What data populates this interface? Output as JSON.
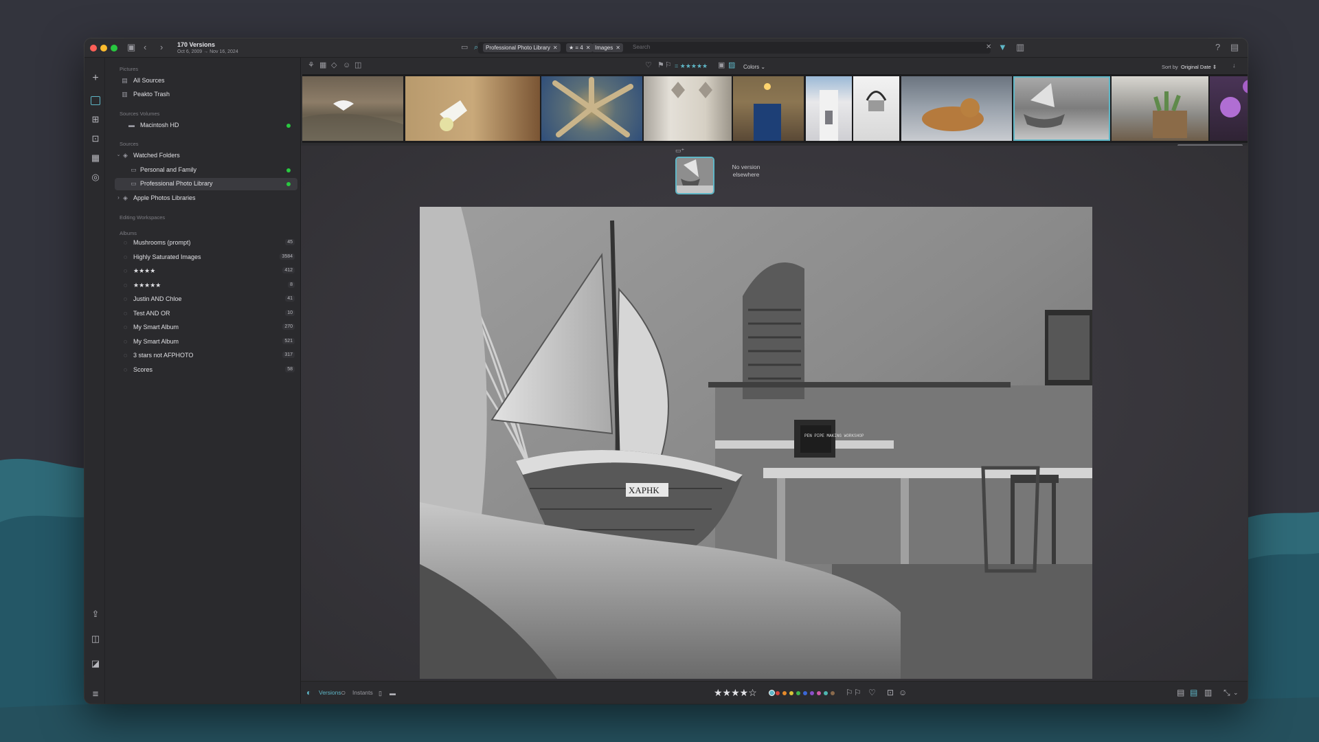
{
  "window": {
    "title": "170 Versions",
    "date_range": "Oct 6, 2009 → Nov 16, 2024"
  },
  "search": {
    "chips": [
      {
        "label": "Professional Photo Library"
      },
      {
        "label": "★ = 4"
      },
      {
        "label": "Images"
      }
    ],
    "placeholder": "Search"
  },
  "sidebar": {
    "sections": {
      "pictures": "Pictures",
      "volumes": "Sources Volumes",
      "sources": "Sources",
      "editing": "Editing Workspaces",
      "albums": "Albums"
    },
    "pictures": [
      {
        "label": "All Sources",
        "icon": "photos-icon"
      },
      {
        "label": "Peakto Trash",
        "icon": "trash-icon"
      }
    ],
    "volumes": [
      {
        "label": "Macintosh HD",
        "icon": "disk-icon",
        "online": true
      }
    ],
    "sources": {
      "watched": "Watched Folders",
      "folders": [
        {
          "label": "Personal and Family",
          "online": true
        },
        {
          "label": "Professional Photo Library",
          "online": true,
          "selected": true
        }
      ],
      "apple": "Apple Photos Libraries"
    },
    "albums": [
      {
        "label": "Mushrooms (prompt)",
        "count": "45"
      },
      {
        "label": "Highly Saturated Images",
        "count": "3584"
      },
      {
        "label": "★★★★",
        "count": "412"
      },
      {
        "label": "★★★★★",
        "count": "8"
      },
      {
        "label": "Justin AND Chloe",
        "count": "41"
      },
      {
        "label": "Test AND OR",
        "count": "10"
      },
      {
        "label": "My Smart Album",
        "count": "270"
      },
      {
        "label": "My Smart Album",
        "count": "521"
      },
      {
        "label": "3 stars not AFPHOTO",
        "count": "317"
      },
      {
        "label": "Scores",
        "count": "58"
      }
    ]
  },
  "toolbar": {
    "rating_filter": "= ★★★★★",
    "colors_label": "Colors",
    "sort_label": "Sort by",
    "sort_value": "Original Date"
  },
  "filmstrip": {
    "thumbnails": [
      "egret-on-shore",
      "seagull-in-flight",
      "agave-on-blue-tiles",
      "white-doors",
      "blue-door-with-lamp",
      "white-church-tower",
      "potted-plant-wall",
      "ginger-cat",
      "boat-workshop-bw",
      "potted-cacti",
      "purple-flowers"
    ],
    "selected_index": 8
  },
  "viewer": {
    "version_note": "No version elsewhere",
    "photo_sign_text": "ΧΑΡΗΚ",
    "board_text": "PEN PIPE MAKING WORKSHOP"
  },
  "bottombar": {
    "versions_label": "Versions",
    "instants_label": "Instants",
    "rating": "★★★★☆",
    "color_labels": [
      "#5fb7c7",
      "#d6453d",
      "#e58a2b",
      "#d9c23a",
      "#3fb54e",
      "#3b67d6",
      "#8a4fc9",
      "#d05aa8",
      "#4eb6b0",
      "#8a6a4c"
    ]
  }
}
